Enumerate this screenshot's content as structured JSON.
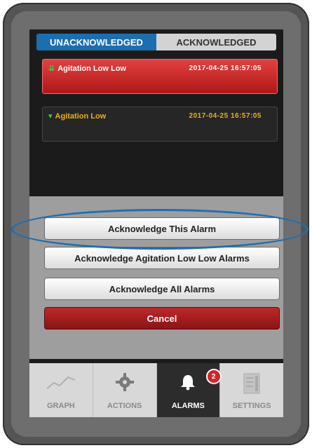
{
  "tabs": {
    "unacknowledged": "UNACKNOWLEDGED",
    "acknowledged": "ACKNOWLEDGED"
  },
  "alarms": [
    {
      "name": "Agitation Low Low",
      "timestamp": "2017-04-25 16:57:05",
      "severity_color": "#d82a2a"
    },
    {
      "name": "Agitation Low",
      "timestamp": "2017-04-25 16:57:05",
      "severity_color": "#e8b020"
    }
  ],
  "actions": {
    "ack_this": "Acknowledge This Alarm",
    "ack_group": "Acknowledge Agitation Low Low Alarms",
    "ack_all": "Acknowledge All Alarms",
    "cancel": "Cancel"
  },
  "nav": {
    "graph": "GRAPH",
    "actions": "ACTIONS",
    "alarms": "ALARMS",
    "alarms_badge": "2",
    "settings": "SETTINGS"
  }
}
